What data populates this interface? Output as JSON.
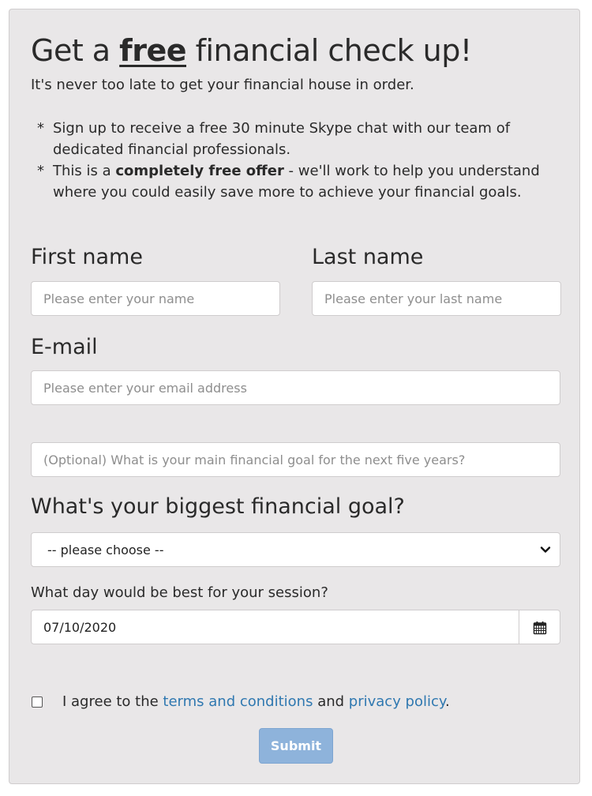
{
  "header": {
    "title_before": "Get a ",
    "title_emphasis": "free",
    "title_after": " financial check up!",
    "subtitle": "It's never too late to get your financial house in order."
  },
  "bullets": [
    {
      "marker": "*",
      "text": "Sign up to receive a free 30 minute Skype chat with our team of dedicated financial professionals."
    },
    {
      "marker": "*",
      "text_before": "This is a ",
      "text_bold": "completely free offer",
      "text_after": " - we'll work to help you understand where you could easily save more to achieve your financial goals."
    }
  ],
  "form": {
    "first_name": {
      "label": "First name",
      "placeholder": "Please enter your name",
      "value": ""
    },
    "last_name": {
      "label": "Last name",
      "placeholder": "Please enter your last name",
      "value": ""
    },
    "email": {
      "label": "E-mail",
      "placeholder": "Please enter your email address",
      "value": ""
    },
    "goal_text": {
      "placeholder": "(Optional) What is your main financial goal for the next five years?",
      "value": ""
    },
    "goal_select": {
      "label": "What's your biggest financial goal?",
      "selected": "-- please choose --"
    },
    "session_date": {
      "label": "What day would be best for your session?",
      "value": "07/10/2020",
      "calendar_icon": "calendar-icon"
    },
    "agree": {
      "checked": false,
      "text_before": "I agree to the ",
      "terms_link": "terms and conditions",
      "text_middle": " and ",
      "privacy_link": "privacy policy",
      "text_after": "."
    },
    "submit_label": "Submit"
  },
  "colors": {
    "card_background": "#e9e7e8",
    "link": "#2f78b0",
    "submit_button": "#8eb3db"
  }
}
